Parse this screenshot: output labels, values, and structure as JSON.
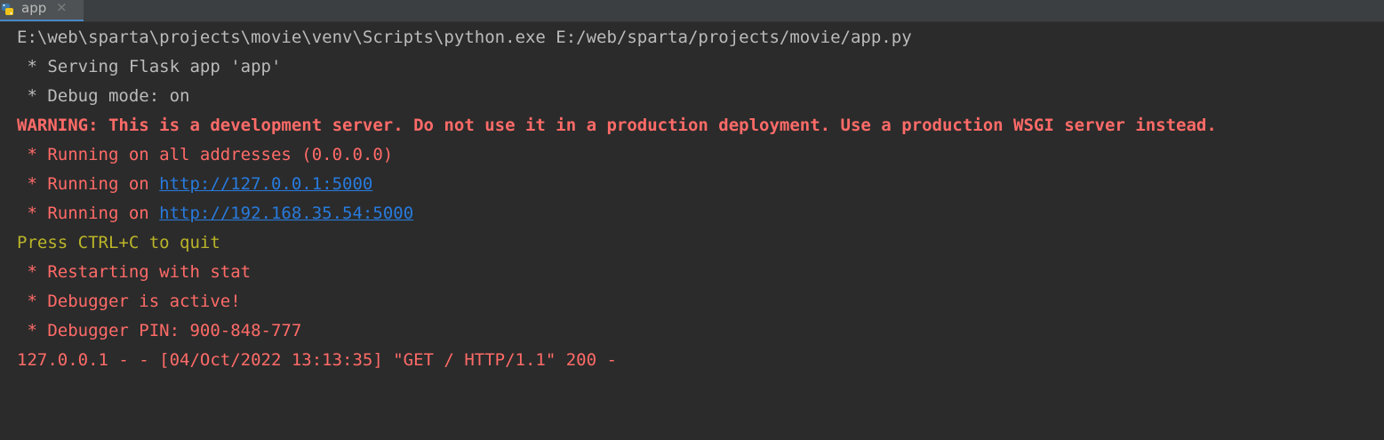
{
  "tab": {
    "icon": "python-icon",
    "label": "app",
    "close_label": "×"
  },
  "console": {
    "lines": [
      {
        "text": "E:\\web\\sparta\\projects\\movie\\venv\\Scripts\\python.exe E:/web/sparta/projects/movie/app.py"
      },
      {
        "text": " * Serving Flask app 'app'"
      },
      {
        "text": " * Debug mode: on"
      },
      {
        "text": "WARNING: This is a development server. Do not use it in a production deployment. Use a production WSGI server instead."
      },
      {
        "text": " * Running on all addresses (0.0.0.0)"
      },
      {
        "prefix": " * Running on ",
        "link": "http://127.0.0.1:5000"
      },
      {
        "prefix": " * Running on ",
        "link": "http://192.168.35.54:5000"
      },
      {
        "text": "Press CTRL+C to quit"
      },
      {
        "text": " * Restarting with stat"
      },
      {
        "text": " * Debugger is active!"
      },
      {
        "text": " * Debugger PIN: 900-848-777"
      },
      {
        "text": "127.0.0.1 - - [04/Oct/2022 13:13:35] \"GET / HTTP/1.1\" 200 -"
      }
    ]
  },
  "colors": {
    "background": "#2b2b2b",
    "stdout": "#bbbbbb",
    "stderr": "#ff6b68",
    "hint": "#bbb529",
    "link": "#287bde"
  }
}
